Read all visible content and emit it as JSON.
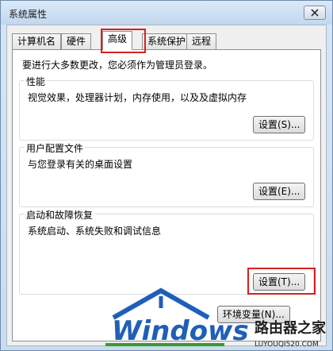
{
  "window": {
    "title": "系统属性",
    "close_label": "close"
  },
  "tabs": [
    {
      "label": "计算机名"
    },
    {
      "label": "硬件"
    },
    {
      "label": "高级",
      "active": true
    },
    {
      "label": "系统保护"
    },
    {
      "label": "远程"
    }
  ],
  "advanced": {
    "notice": "要进行大多数更改，您必须作为管理员登录。",
    "performance": {
      "title": "性能",
      "description": "视觉效果，处理器计划，内存使用，以及及虚拟内存",
      "button": "设置(S)..."
    },
    "user_profiles": {
      "title": "用户配置文件",
      "description": "与您登录有关的桌面设置",
      "button": "设置(E)..."
    },
    "startup_recovery": {
      "title": "启动和故障恢复",
      "description": "系统启动、系统失败和调试信息",
      "button": "设置(T)..."
    },
    "env_button": "环境变量(N)..."
  },
  "watermark": {
    "logo_text": "Windows",
    "site_name": "路由器之家",
    "site_url": "LUYOUQI520.COM"
  },
  "colors": {
    "highlight": "#d62020",
    "watermark_blue": "#1f5fb8",
    "watermark_green": "#3b9a2f"
  }
}
